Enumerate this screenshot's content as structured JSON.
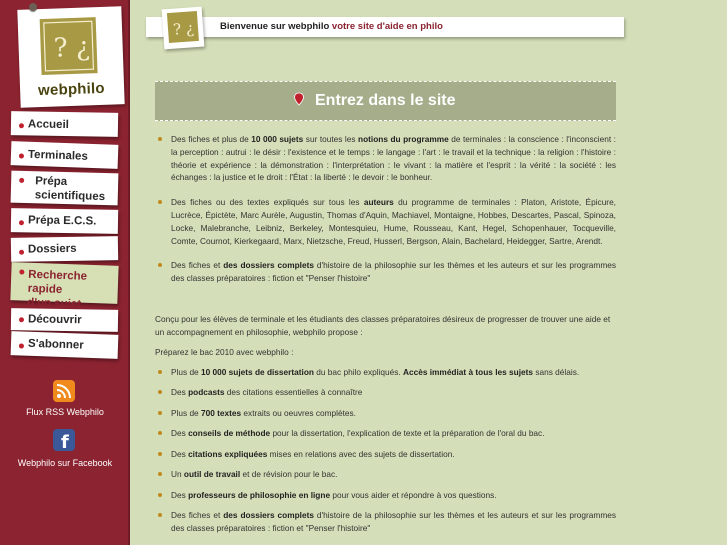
{
  "brand": {
    "logo_symbol": "? ¿",
    "logo_text": "webphilo"
  },
  "header": {
    "welcome": "Bienvenue sur webphilo",
    "tagline": "votre site d'aide en philo"
  },
  "banner": {
    "title": "Entrez dans le site"
  },
  "sidebar": {
    "menu": [
      {
        "label": "Accueil"
      },
      {
        "label": "Terminales"
      },
      {
        "label": "Prépa\nscientifiques"
      },
      {
        "label": "Prépa E.C.S."
      },
      {
        "label": "Dossiers"
      },
      {
        "label": "Recherche rapide\nd'un sujet"
      },
      {
        "label": "Découvrir"
      },
      {
        "label": "S'abonner"
      }
    ],
    "rss_label": "Flux RSS Webphilo",
    "facebook_label": "Webphilo sur Facebook"
  },
  "intro_list": [
    {
      "parts": [
        {
          "t": "Des fiches et plus de "
        },
        {
          "t": "10 000 sujets",
          "b": true
        },
        {
          "t": " sur toutes les "
        },
        {
          "t": "notions du programme",
          "b": true
        },
        {
          "t": " de terminales : la conscience : l'inconscient : la perception : autrui : le désir : l'existence et le temps : le langage : l'art : le travail et la technique : la religion : l'histoire : théorie et expérience : la démonstration : l'interprétation : le vivant : la matière et l'esprit : la vérité : la société : les échanges : la justice et le droit : l'État : la liberté : le devoir : le bonheur."
        }
      ]
    },
    {
      "parts": [
        {
          "t": "Des fiches ou des textes expliqués sur tous les "
        },
        {
          "t": "auteurs",
          "b": true
        },
        {
          "t": " du programme de terminales : Platon, Aristote, Épicure, Lucrèce, Épictète, Marc Aurèle, Augustin, Thomas d'Aquin, Machiavel, Montaigne, Hobbes, Descartes, Pascal, Spinoza, Locke, Malebranche, Leibniz, Berkeley, Montesquieu, Hume, Rousseau, Kant, Hegel, Schopenhauer, Tocqueville, Comte, Cournot, Kierkegaard, Marx, Nietzsche, Freud, Husserl, Bergson, Alain, Bachelard, Heidegger, Sartre, Arendt."
        }
      ]
    },
    {
      "parts": [
        {
          "t": "Des fiches et "
        },
        {
          "t": "des dossiers complets",
          "b": true
        },
        {
          "t": " d'histoire de la philosophie sur les thèmes et les auteurs et sur les programmes des classes préparatoires : fiction et \"Penser l'histoire\""
        }
      ]
    }
  ],
  "para_audience": "Conçu pour les élèves de terminale et les étudiants des classes préparatoires désireux de progresser de trouver une aide et un accompagnement en philosophie, webphilo propose :",
  "para_bac": "Préparez le bac 2010 avec webphilo :",
  "features_list": [
    {
      "parts": [
        {
          "t": "Plus de "
        },
        {
          "t": "10 000 sujets de dissertation",
          "b": true
        },
        {
          "t": " du bac philo expliqués. "
        },
        {
          "t": "Accès immédiat à tous les sujets",
          "b": true
        },
        {
          "t": " sans délais."
        }
      ]
    },
    {
      "parts": [
        {
          "t": "Des "
        },
        {
          "t": "podcasts",
          "b": true
        },
        {
          "t": " des citations essentielles à connaître"
        }
      ]
    },
    {
      "parts": [
        {
          "t": "Plus de "
        },
        {
          "t": "700 textes",
          "b": true
        },
        {
          "t": " extraits ou oeuvres complètes."
        }
      ]
    },
    {
      "parts": [
        {
          "t": "Des "
        },
        {
          "t": "conseils de méthode",
          "b": true
        },
        {
          "t": " pour la dissertation, l'explication de texte et la préparation de l'oral du bac."
        }
      ]
    },
    {
      "parts": [
        {
          "t": "Des "
        },
        {
          "t": "citations expliquées",
          "b": true
        },
        {
          "t": " mises en relations avec des sujets de dissertation."
        }
      ]
    },
    {
      "parts": [
        {
          "t": "Un "
        },
        {
          "t": "outil de travail",
          "b": true
        },
        {
          "t": " et de révision pour le bac."
        }
      ]
    },
    {
      "parts": [
        {
          "t": "Des "
        },
        {
          "t": "professeurs de philosophie en ligne",
          "b": true
        },
        {
          "t": " pour vous aider et répondre à vos questions."
        }
      ]
    },
    {
      "parts": [
        {
          "t": "Des fiches et "
        },
        {
          "t": "des dossiers complets",
          "b": true
        },
        {
          "t": " d'histoire de la philosophie sur les thèmes et les auteurs et sur les programmes des classes préparatoires : fiction et \"Penser l'histoire\""
        }
      ]
    }
  ],
  "colors": {
    "sidebar": "#8b2330",
    "background": "#d4deb8",
    "accent": "#8b2330",
    "banner": "#a6ad8a",
    "bullet": "#c08a1f"
  },
  "icons": {
    "rss": "rss-icon",
    "facebook": "facebook-icon",
    "banner": "location-pin-icon"
  }
}
